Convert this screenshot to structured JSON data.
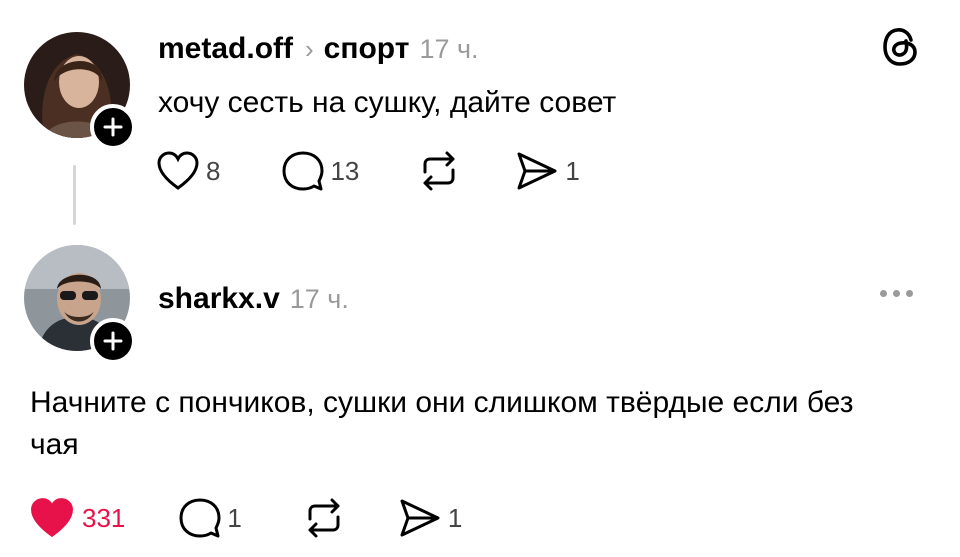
{
  "colors": {
    "text": "#000000",
    "muted": "#9a9a9a",
    "like_active": "#e8124a",
    "thread_line": "#d6d6d6"
  },
  "posts": [
    {
      "username": "metad.off",
      "separator_icon": "chevron-right-icon",
      "topic": "спорт",
      "time": "17 ч.",
      "text": "хочу сесть на сушку, дайте совет",
      "likes": "8",
      "liked": false,
      "replies": "13",
      "reposts": "",
      "shares": "1"
    },
    {
      "username": "sharkx.v",
      "time": "17 ч.",
      "text": "Начните с пончиков, сушки они слишком твёрдые если без чая",
      "likes": "331",
      "liked": true,
      "replies": "1",
      "reposts": "",
      "shares": "1"
    }
  ],
  "icons": {
    "app_logo": "threads-logo-icon",
    "more": "more-horizontal-icon",
    "like": "heart-icon",
    "reply": "comment-icon",
    "repost": "repost-icon",
    "share": "send-icon",
    "follow": "plus-icon"
  }
}
